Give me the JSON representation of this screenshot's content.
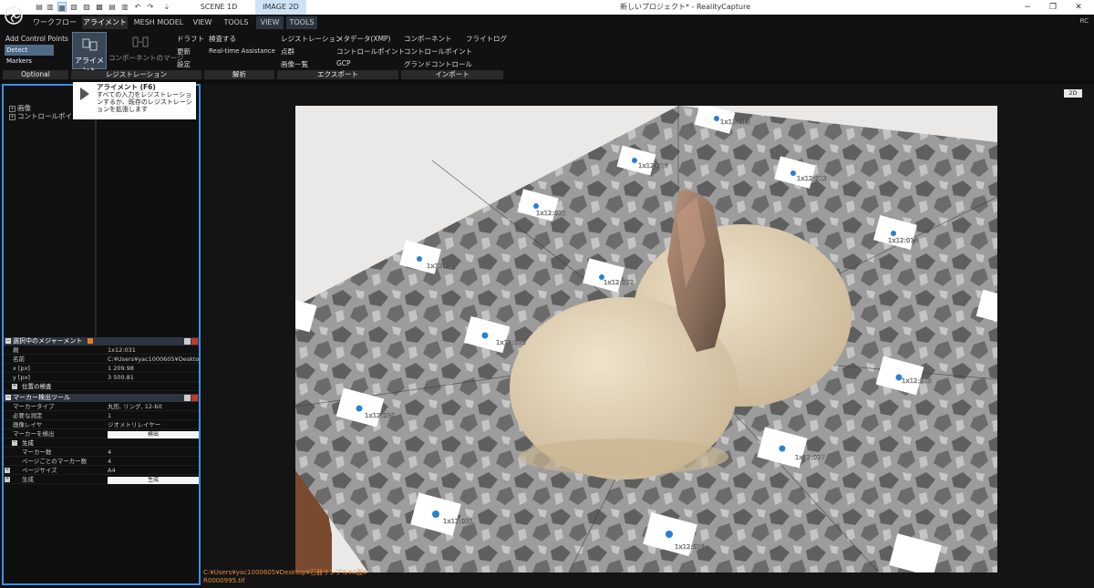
{
  "titlebar": {
    "tabs": [
      {
        "label": "SCENE 1D",
        "active": false
      },
      {
        "label": "IMAGE 2D",
        "active": true
      }
    ],
    "window_title": "新しいプロジェクト* - RealityCapture",
    "controls": [
      "−",
      "❐",
      "✕"
    ]
  },
  "menu": {
    "tabs": [
      {
        "label": "ワークフロー",
        "active": false
      },
      {
        "label": "アライメント",
        "active": true
      },
      {
        "label": "MESH MODEL",
        "active": false
      },
      {
        "label": "VIEW",
        "active": false
      },
      {
        "label": "TOOLS",
        "active": false
      },
      {
        "label": "VIEW",
        "active": false,
        "alt": true
      },
      {
        "label": "TOOLS",
        "active": false,
        "alt": true
      }
    ],
    "user": "RC"
  },
  "ribbon": {
    "add_control_points": "Add Control Points",
    "detect_markers": "Detect Markers",
    "alignment": "アライメント",
    "component_merge": "コンポーネントのマージ",
    "draft": "ドラフト",
    "update": "更新",
    "settings": "設定",
    "inspect": "検査する",
    "realtime": "Real-time Assistance",
    "registration": "レジストレーション",
    "point_cloud": "点群",
    "image_list": "画像一覧",
    "metadata": "メタデータ(XMP)",
    "control_points": "コントロールポイント",
    "gcp": "GCP",
    "components": "コンポーネント",
    "control_points_import": "コントロールポイント",
    "ground_control": "グランドコントロール",
    "flight_log": "フライトログ",
    "groups": {
      "optional": "Optional",
      "registration": "レジストレーション",
      "analysis": "解析",
      "export": "エクスポート",
      "import": "インポート"
    }
  },
  "tree": {
    "items": [
      "画像",
      "コントロールポイント"
    ]
  },
  "tooltip": {
    "title": "アライメント (F6)",
    "body": "すべての入力をレジストレーションするか、既存のレジストレーションを拡張します"
  },
  "measurement": {
    "title": "選択中のメジャーメント",
    "rows": [
      {
        "k": "親",
        "v": "1x12:031"
      },
      {
        "k": "名前",
        "v": "C:¥Users¥yac1000605¥Desktop¥..."
      },
      {
        "k": "x [px]",
        "v": "1 209.98"
      },
      {
        "k": "y [px]",
        "v": "3 500.81"
      }
    ],
    "position_inspect": "位置の検査"
  },
  "marker_tool": {
    "title": "マーカー検出ツール",
    "rows": [
      {
        "k": "マーカータイプ",
        "v": "丸形, リング, 12-bit"
      },
      {
        "k": "必要な測定",
        "v": "1"
      },
      {
        "k": "画像レイヤ",
        "v": "ジオメトリレイヤー"
      }
    ],
    "detect_label": "マーカーを検出",
    "detect_button": "検出",
    "generate_group": "生成",
    "gen_rows": [
      {
        "k": "マーカー数",
        "v": "4"
      },
      {
        "k": "ページごとのマーカー数",
        "v": "4"
      },
      {
        "k": "ページサイズ",
        "v": "A4"
      }
    ],
    "generate_label": "生成",
    "generate_button": "生成"
  },
  "viewport": {
    "mode_badge": "2D",
    "markers": [
      "1x12:012",
      "1x12:019",
      "1x12:013",
      "1x12:021",
      "1x12:014",
      "1x12:023",
      "1x12:022",
      "1x12:025",
      "1x12:015",
      "1x12:030",
      "1x12:027",
      "1x12:031",
      "1x12:028"
    ],
    "path": "C:¥Users¥yac1000605¥Desktop¥石器サンプル¥A面¥",
    "filename": "R0000995.tif"
  }
}
